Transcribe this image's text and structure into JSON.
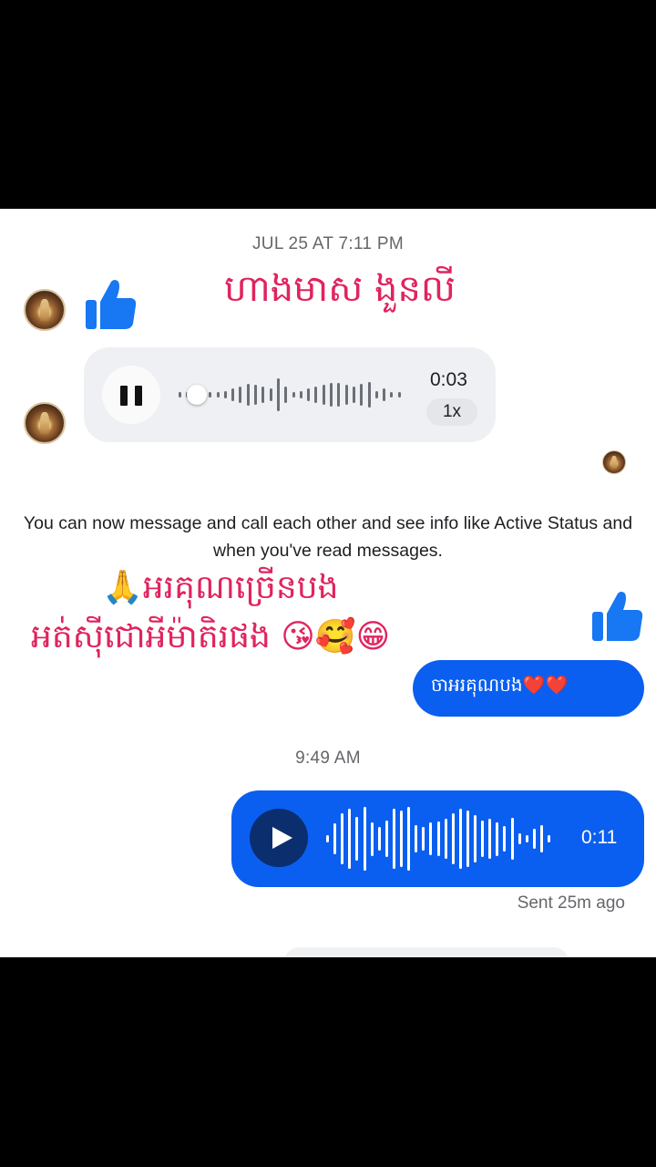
{
  "thread": {
    "timestamp_1": "JUL 25 AT 7:11 PM",
    "incoming_text_1": "ហាងមាស ងួនលី",
    "incoming_voice": {
      "duration": "0:03",
      "speed": "1x",
      "progress": 0.08
    },
    "system_notice": "You can now message and call each other and see info like Active Status and when you've read messages.",
    "overlay_line_1": "🙏អរគុណច្រើនបង",
    "overlay_line_2": "អត់ស៊ីជោអីម៉ាតិរផង 😘🥰😁",
    "outgoing_text": "ចាអរគុណបង❤️❤️",
    "timestamp_2": "9:49 AM",
    "outgoing_voice": {
      "duration": "0:11"
    },
    "status": "Sent 25m ago"
  },
  "colors": {
    "messenger_blue": "#0a5ff0",
    "like_blue": "#1877f2",
    "overlay_red": "#e0245e",
    "meta_gray": "#65676b"
  },
  "icons": [
    "avatar",
    "like-thumb-icon",
    "pause-icon",
    "play-icon",
    "read-receipt-avatar"
  ]
}
